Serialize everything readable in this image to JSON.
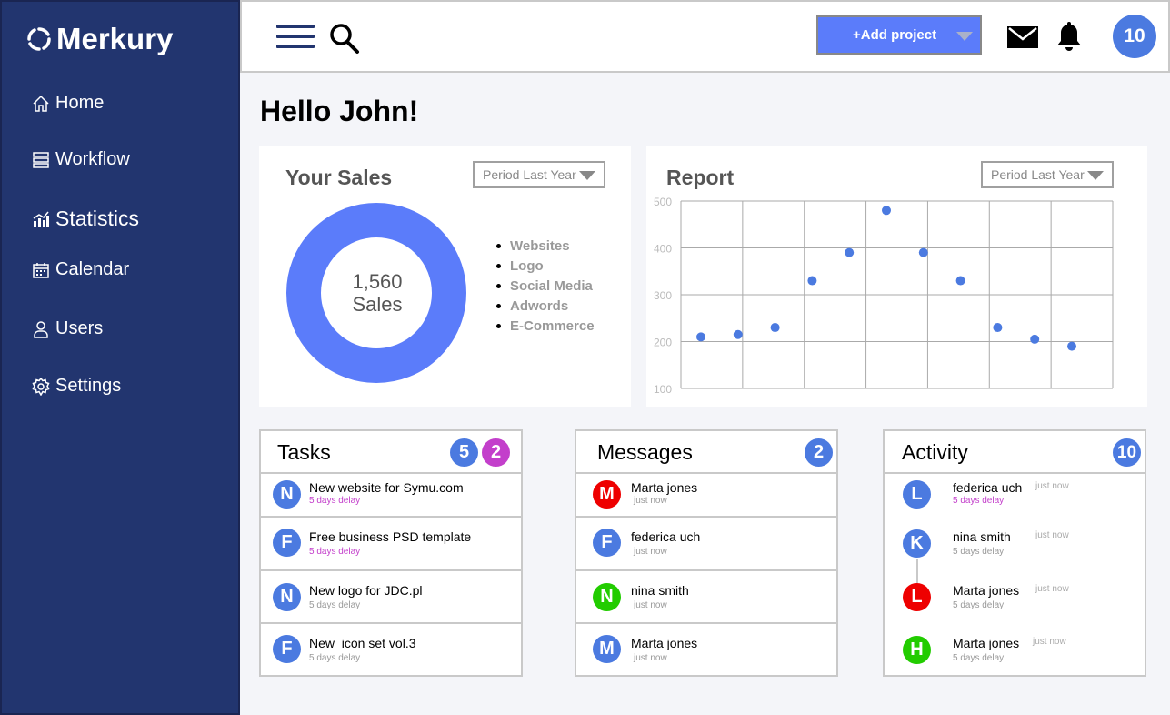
{
  "sidebar": {
    "brand": "Merkury",
    "items": [
      {
        "label": "Home",
        "icon": "home-icon"
      },
      {
        "label": "Workflow",
        "icon": "workflow-icon"
      },
      {
        "label": "Statistics",
        "icon": "statistics-icon"
      },
      {
        "label": "Calendar",
        "icon": "calendar-icon"
      },
      {
        "label": "Users",
        "icon": "user-icon"
      },
      {
        "label": "Settings",
        "icon": "gear-icon"
      }
    ]
  },
  "header": {
    "add_project_label": "+Add project",
    "notification_count": "10"
  },
  "greeting": "Hello John!",
  "sales": {
    "title": "Your Sales",
    "period": "Period Last Year",
    "total": "1,560",
    "total_label": "Sales",
    "legend": [
      "Websites",
      "Logo",
      "Social Media",
      "Adwords",
      "E-Commerce"
    ]
  },
  "report": {
    "title": "Report",
    "period": "Period Last Year"
  },
  "chart_data": {
    "type": "scatter",
    "title": "Report",
    "y_ticks": [
      "500",
      "400",
      "300",
      "200",
      "100"
    ],
    "ylim": [
      100,
      500
    ],
    "grid": true,
    "x": [
      1,
      2,
      3,
      4,
      5,
      6,
      7,
      8,
      9,
      10,
      11,
      12
    ],
    "values": [
      210,
      215,
      230,
      330,
      390,
      480,
      390,
      330,
      230,
      205,
      190
    ]
  },
  "tasks": {
    "title": "Tasks",
    "badges": [
      "5",
      "2"
    ],
    "items": [
      {
        "initial": "N",
        "title": "New website for Symu.com",
        "sub": "5 days delay",
        "late": true,
        "color": "#4b7ae0"
      },
      {
        "initial": "F",
        "title": "Free business PSD template",
        "sub": "5 days delay",
        "late": true,
        "color": "#4b7ae0"
      },
      {
        "initial": "N",
        "title": "New logo for JDC.pl",
        "sub": "5 days delay",
        "late": false,
        "color": "#4b7ae0"
      },
      {
        "initial": "F",
        "title": "New  icon set vol.3",
        "sub": "5 days delay",
        "late": false,
        "color": "#4b7ae0"
      }
    ]
  },
  "messages": {
    "title": "Messages",
    "badge": "2",
    "items": [
      {
        "initial": "M",
        "title": "Marta jones",
        "sub": "just now",
        "color": "#ee0000"
      },
      {
        "initial": "F",
        "title": "federica uch",
        "sub": "just now",
        "color": "#4b7ae0"
      },
      {
        "initial": "N",
        "title": "nina smith",
        "sub": "just now",
        "color": "#22cc00"
      },
      {
        "initial": "M",
        "title": "Marta jones",
        "sub": "just now",
        "color": "#4b7ae0"
      }
    ]
  },
  "activity": {
    "title": "Activity",
    "badge": "10",
    "items": [
      {
        "initial": "L",
        "title": "federica uch",
        "sub": "5 days delay",
        "time": "just now",
        "late": true,
        "color": "#4b7ae0"
      },
      {
        "initial": "K",
        "title": "nina smith",
        "sub": "5 days delay",
        "time": "just now",
        "late": false,
        "color": "#4b7ae0"
      },
      {
        "initial": "L",
        "title": "Marta jones",
        "sub": "5 days delay",
        "time": "just now",
        "late": false,
        "color": "#ee0000"
      },
      {
        "initial": "H",
        "title": "Marta jones",
        "sub": "5 days delay",
        "time": "just now",
        "late": false,
        "color": "#22cc00"
      }
    ]
  },
  "colors": {
    "sidebar": "#22356f",
    "accent": "#5b7cfa",
    "badge_blue": "#4b7ae0",
    "badge_purple": "#c33fcb"
  }
}
